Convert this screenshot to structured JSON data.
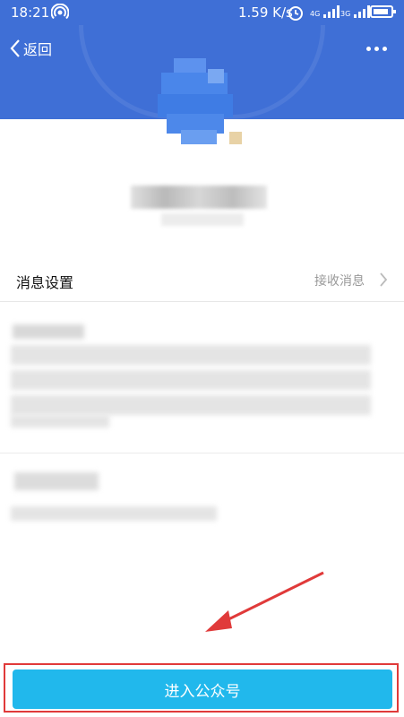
{
  "status_bar": {
    "time": "18:21",
    "network_speed": "1.59 K/s",
    "signal_1": "4G",
    "signal_2": "3G"
  },
  "header": {
    "back_label": "返回",
    "more_icon": "more-dots-icon",
    "background_color": "#3f6fd6"
  },
  "message_settings": {
    "label": "消息设置",
    "value": "接收消息"
  },
  "footer": {
    "enter_button_label": "进入公众号",
    "button_color": "#21b8ec",
    "highlight_color": "#e03a3a"
  },
  "annotation": {
    "arrow_color": "#e03a3a"
  }
}
